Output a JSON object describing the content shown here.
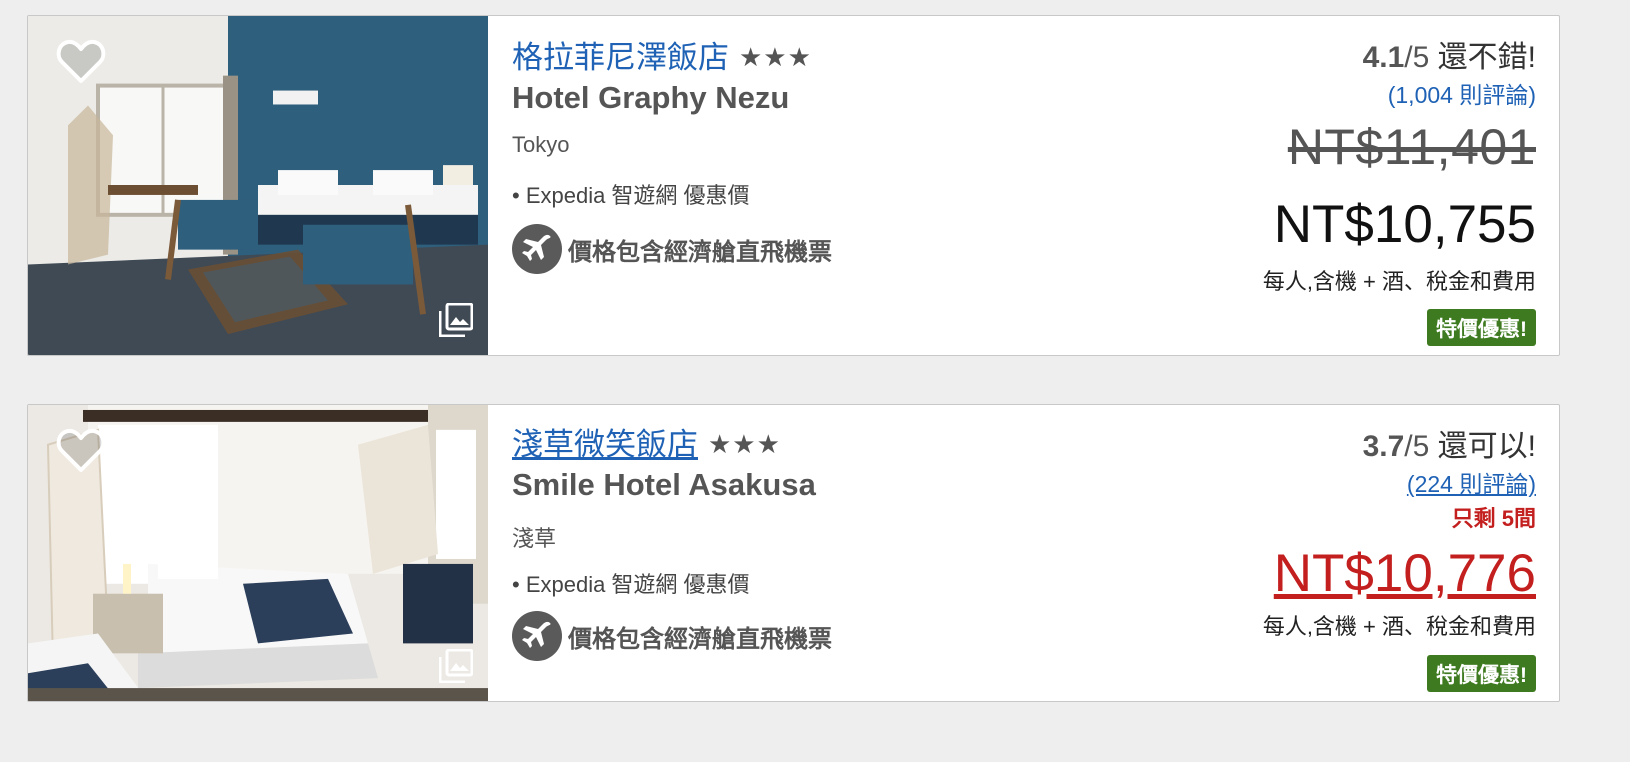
{
  "hotels": [
    {
      "name_cn": "格拉菲尼澤飯店",
      "stars": "★★★",
      "name_en": "Hotel Graphy Nezu",
      "location": "Tokyo",
      "deal_source": "• Expedia 智遊網 優惠價",
      "flight_note": "價格包含經濟艙直飛機票",
      "rating_score": "4.1",
      "rating_denominator": "/5",
      "rating_text": "還不錯!",
      "reviews": "(1,004 則評論)",
      "old_price": "NT$11,401",
      "price": "NT$10,755",
      "price_note": "每人,含機 + 酒、稅金和費用",
      "badge": "特價優惠!"
    },
    {
      "name_cn": "淺草微笑飯店",
      "stars": "★★★",
      "name_en": "Smile Hotel Asakusa",
      "location": "淺草",
      "deal_source": "• Expedia 智遊網 優惠價",
      "flight_note": "價格包含經濟艙直飛機票",
      "rating_score": "3.7",
      "rating_denominator": "/5",
      "rating_text": "還可以!",
      "reviews": "(224 則評論)",
      "scarcity": "只剩 5間",
      "price": "NT$10,776",
      "price_note": "每人,含機 + 酒、稅金和費用",
      "badge": "特價優惠!"
    }
  ],
  "colors": {
    "link": "#1f62b5",
    "deal_badge": "#3e7a1f",
    "urgent": "#c41f1f",
    "background": "#eeeeee"
  },
  "icons": [
    "heart-icon",
    "gallery-icon",
    "airplane-icon"
  ]
}
